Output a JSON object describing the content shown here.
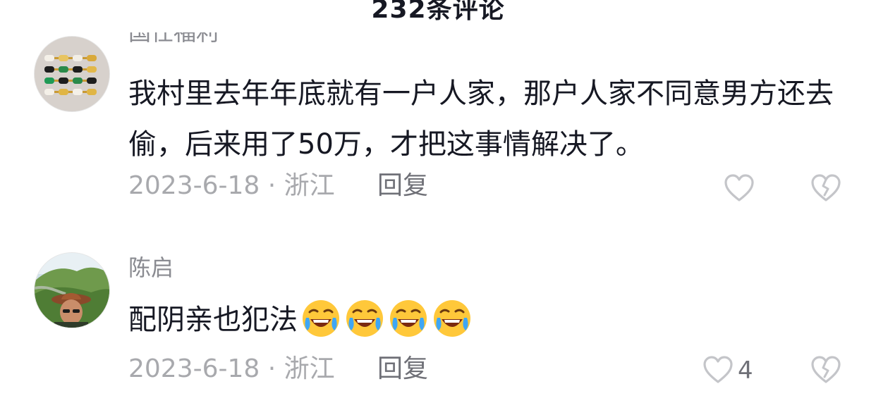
{
  "header": {
    "title": "232条评论"
  },
  "comments": [
    {
      "username": "国仕福利",
      "text": "我村里去年年底就有一户人家，那户人家不同意男方还去偷，后来用了50万，才把这事情解决了。",
      "date_location": "2023-6-18 · 浙江",
      "reply_label": "回复",
      "like_count": "",
      "avatar_icon": "jewelry-avatar-icon"
    },
    {
      "username": "陈启",
      "text": "配阴亲也犯法",
      "emojis": [
        "laughing-crying-emoji",
        "laughing-crying-emoji",
        "laughing-crying-emoji",
        "laughing-crying-emoji"
      ],
      "date_location": "2023-6-18 · 浙江",
      "reply_label": "回复",
      "like_count": "4",
      "avatar_icon": "landscape-person-avatar-icon"
    }
  ],
  "colors": {
    "text_primary": "#161823",
    "text_secondary": "#a8a9ad",
    "icon_gray": "#c4c5c9"
  }
}
